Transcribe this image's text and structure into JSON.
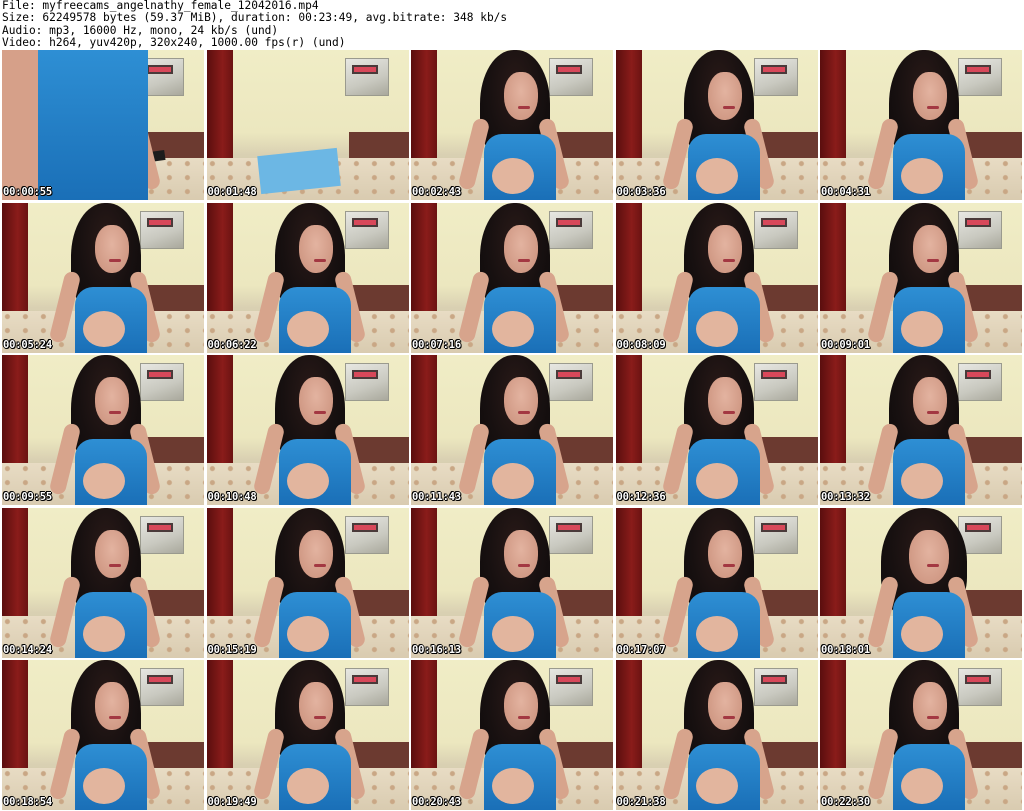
{
  "header": {
    "file": "File: myfreecams_angelnathy_female_12042016.mp4",
    "size": "Size: 62249578 bytes (59.37 MiB), duration: 00:23:49, avg.bitrate: 348 kb/s",
    "audio": "Audio: mp3, 16000 Hz, mono, 24 kb/s (und)",
    "video": "Video: h264, yuv420p, 320x240, 1000.00 fps(r) (und)"
  },
  "thumbnails": [
    {
      "time": "00:00:55",
      "variant": "first"
    },
    {
      "time": "00:01:48",
      "variant": "bed"
    },
    {
      "time": "00:02:43",
      "variant": "normal"
    },
    {
      "time": "00:03:36",
      "variant": "normal"
    },
    {
      "time": "00:04:31",
      "variant": "normal"
    },
    {
      "time": "00:05:24",
      "variant": "normal"
    },
    {
      "time": "00:06:22",
      "variant": "normal"
    },
    {
      "time": "00:07:16",
      "variant": "normal"
    },
    {
      "time": "00:08:09",
      "variant": "normal"
    },
    {
      "time": "00:09:01",
      "variant": "normal"
    },
    {
      "time": "00:09:55",
      "variant": "normal"
    },
    {
      "time": "00:10:48",
      "variant": "normal"
    },
    {
      "time": "00:11:43",
      "variant": "normal"
    },
    {
      "time": "00:12:36",
      "variant": "normal"
    },
    {
      "time": "00:13:32",
      "variant": "normal"
    },
    {
      "time": "00:14:24",
      "variant": "normal"
    },
    {
      "time": "00:15:19",
      "variant": "normal"
    },
    {
      "time": "00:16:13",
      "variant": "normal"
    },
    {
      "time": "00:17:07",
      "variant": "normal"
    },
    {
      "time": "00:18:01",
      "variant": "closeup"
    },
    {
      "time": "00:18:54",
      "variant": "normal"
    },
    {
      "time": "00:19:49",
      "variant": "normal"
    },
    {
      "time": "00:20:43",
      "variant": "normal"
    },
    {
      "time": "00:21:38",
      "variant": "normal"
    },
    {
      "time": "00:22:30",
      "variant": "normal"
    }
  ]
}
